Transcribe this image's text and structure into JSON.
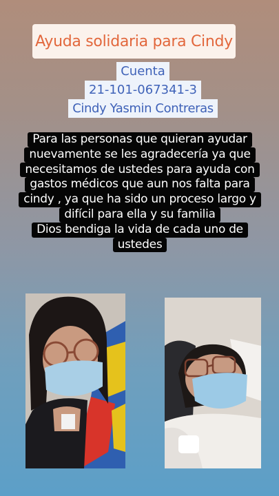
{
  "title": "Ayuda solidaria para Cindy",
  "account": {
    "label": "Cuenta",
    "number": "21-101-067341-3",
    "holder": "Cindy Yasmin Contreras"
  },
  "message_lines": [
    "Para las personas que quieran ayudar",
    "nuevamente se les agradecería ya que",
    "necesitamos  de ustedes para ayuda con",
    "gastos médicos que aun nos falta para",
    "cindy , ya que ha sido un proceso largo y",
    "difícil para ella y su familia",
    "Dios bendiga la vida de cada uno de",
    "ustedes"
  ],
  "colors": {
    "title_text": "#e2673c",
    "account_text": "#3f62b8",
    "message_bg": "#050505"
  }
}
